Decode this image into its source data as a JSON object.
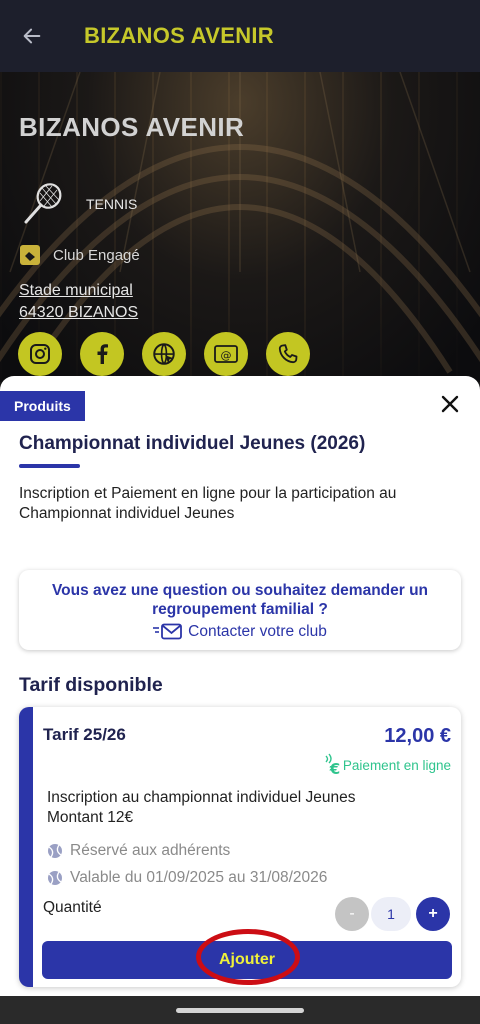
{
  "app_bar": {
    "title": "BIZANOS AVENIR",
    "back_icon": "arrow-left-icon"
  },
  "club": {
    "name": "BIZANOS AVENIR",
    "sport": "TENNIS",
    "engaged_label": "Club Engagé",
    "address_line1": "Stade municipal",
    "address_line2": "64320 BIZANOS",
    "social_icons": [
      "instagram-icon",
      "facebook-icon",
      "website-icon",
      "email-icon",
      "phone-icon"
    ],
    "accent_color": "#c3c622"
  },
  "sheet": {
    "tag": "Produits",
    "product_title": "Championnat individuel Jeunes (2026)",
    "product_description": "Inscription et Paiement en ligne pour la participation au Championnat individuel Jeunes",
    "question_text": "Vous avez une question ou souhaitez demander un regroupement familial ?",
    "contact_label": "Contacter votre club",
    "section_title": "Tarif disponible",
    "brand_color": "#2b35a8",
    "tarif": {
      "name": "Tarif 25/26",
      "price": "12,00 €",
      "payment_label": "Paiement en ligne",
      "description_line1": "Inscription au championnat individuel Jeunes",
      "description_line2": "Montant 12€",
      "reserved_label": "Réservé aux adhérents",
      "validity_label": "Valable du 01/09/2025 au 31/08/2026",
      "quantity_label": "Quantité",
      "quantity_minus": "-",
      "quantity_value": "1",
      "quantity_plus": "+",
      "add_button_label": "Ajouter"
    }
  }
}
